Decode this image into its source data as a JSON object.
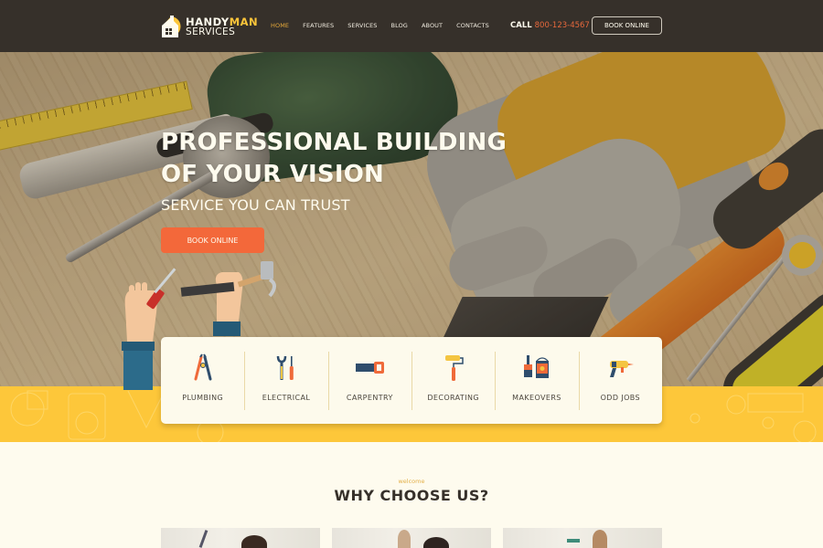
{
  "brand": {
    "name_part1": "HANDY",
    "name_part2": "MAN",
    "name_line2": "SERVICES",
    "logo_icon": "house-icon"
  },
  "nav": {
    "items": [
      {
        "label": "HOME",
        "active": true
      },
      {
        "label": "FEATURES",
        "active": false
      },
      {
        "label": "SERVICES",
        "active": false
      },
      {
        "label": "BLOG",
        "active": false
      },
      {
        "label": "ABOUT",
        "active": false
      },
      {
        "label": "CONTACTS",
        "active": false
      }
    ]
  },
  "header": {
    "call_label": "CALL",
    "phone": "800-123-4567",
    "book_label": "BOOK ONLINE"
  },
  "hero": {
    "title_line1": "PROFESSIONAL BUILDING",
    "title_line2": "OF YOUR VISION",
    "subtitle": "SERVICE YOU CAN TRUST",
    "cta_label": "BOOK ONLINE"
  },
  "services": [
    {
      "label": "PLUMBING",
      "icon": "pliers-icon"
    },
    {
      "label": "ELECTRICAL",
      "icon": "wrench-screwdriver-icon"
    },
    {
      "label": "CARPENTRY",
      "icon": "saw-icon"
    },
    {
      "label": "DECORATING",
      "icon": "paint-roller-icon"
    },
    {
      "label": "MAKEOVERS",
      "icon": "paint-bucket-icon"
    },
    {
      "label": "ODD JOBS",
      "icon": "drill-icon"
    }
  ],
  "why": {
    "eyebrow": "welcome",
    "title": "WHY CHOOSE US?"
  },
  "colors": {
    "header_bg": "#36302a",
    "accent_yellow": "#fdc73a",
    "accent_orange": "#f3683a",
    "phone_color": "#e7683c",
    "nav_active": "#e6a93a",
    "page_bg": "#fefbee"
  }
}
